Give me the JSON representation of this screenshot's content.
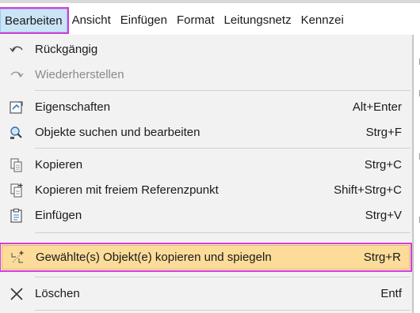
{
  "menubar": {
    "items": [
      {
        "label": "Bearbeiten"
      },
      {
        "label": "Ansicht"
      },
      {
        "label": "Einfügen"
      },
      {
        "label": "Format"
      },
      {
        "label": "Leitungsnetz"
      },
      {
        "label": "Kennzei"
      }
    ]
  },
  "dropdown": {
    "items": [
      {
        "label": "Rückgängig",
        "shortcut": "",
        "icon": "undo-icon",
        "disabled": false
      },
      {
        "label": "Wiederherstellen",
        "shortcut": "",
        "icon": "redo-icon",
        "disabled": true
      },
      {
        "label": "Eigenschaften",
        "shortcut": "Alt+Enter",
        "icon": "properties-icon",
        "disabled": false
      },
      {
        "label": "Objekte suchen und bearbeiten",
        "shortcut": "Strg+F",
        "icon": "find-objects-icon",
        "disabled": false
      },
      {
        "label": "Kopieren",
        "shortcut": "Strg+C",
        "icon": "copy-icon",
        "disabled": false
      },
      {
        "label": "Kopieren mit freiem Referenzpunkt",
        "shortcut": "Shift+Strg+C",
        "icon": "copy-reference-icon",
        "disabled": false
      },
      {
        "label": "Einfügen",
        "shortcut": "Strg+V",
        "icon": "paste-icon",
        "disabled": false
      },
      {
        "label": "Gewählte(s) Objekt(e) kopieren und spiegeln",
        "shortcut": "Strg+R",
        "icon": "copy-mirror-icon",
        "disabled": false
      },
      {
        "label": "Löschen",
        "shortcut": "Entf",
        "icon": "delete-icon",
        "disabled": false
      }
    ]
  },
  "colors": {
    "active_menubar_bg": "#cce4f7",
    "highlight_bg": "#fddc9a",
    "annotation_outline": "#d63ad6",
    "menu_bg": "#f2f2f2"
  }
}
